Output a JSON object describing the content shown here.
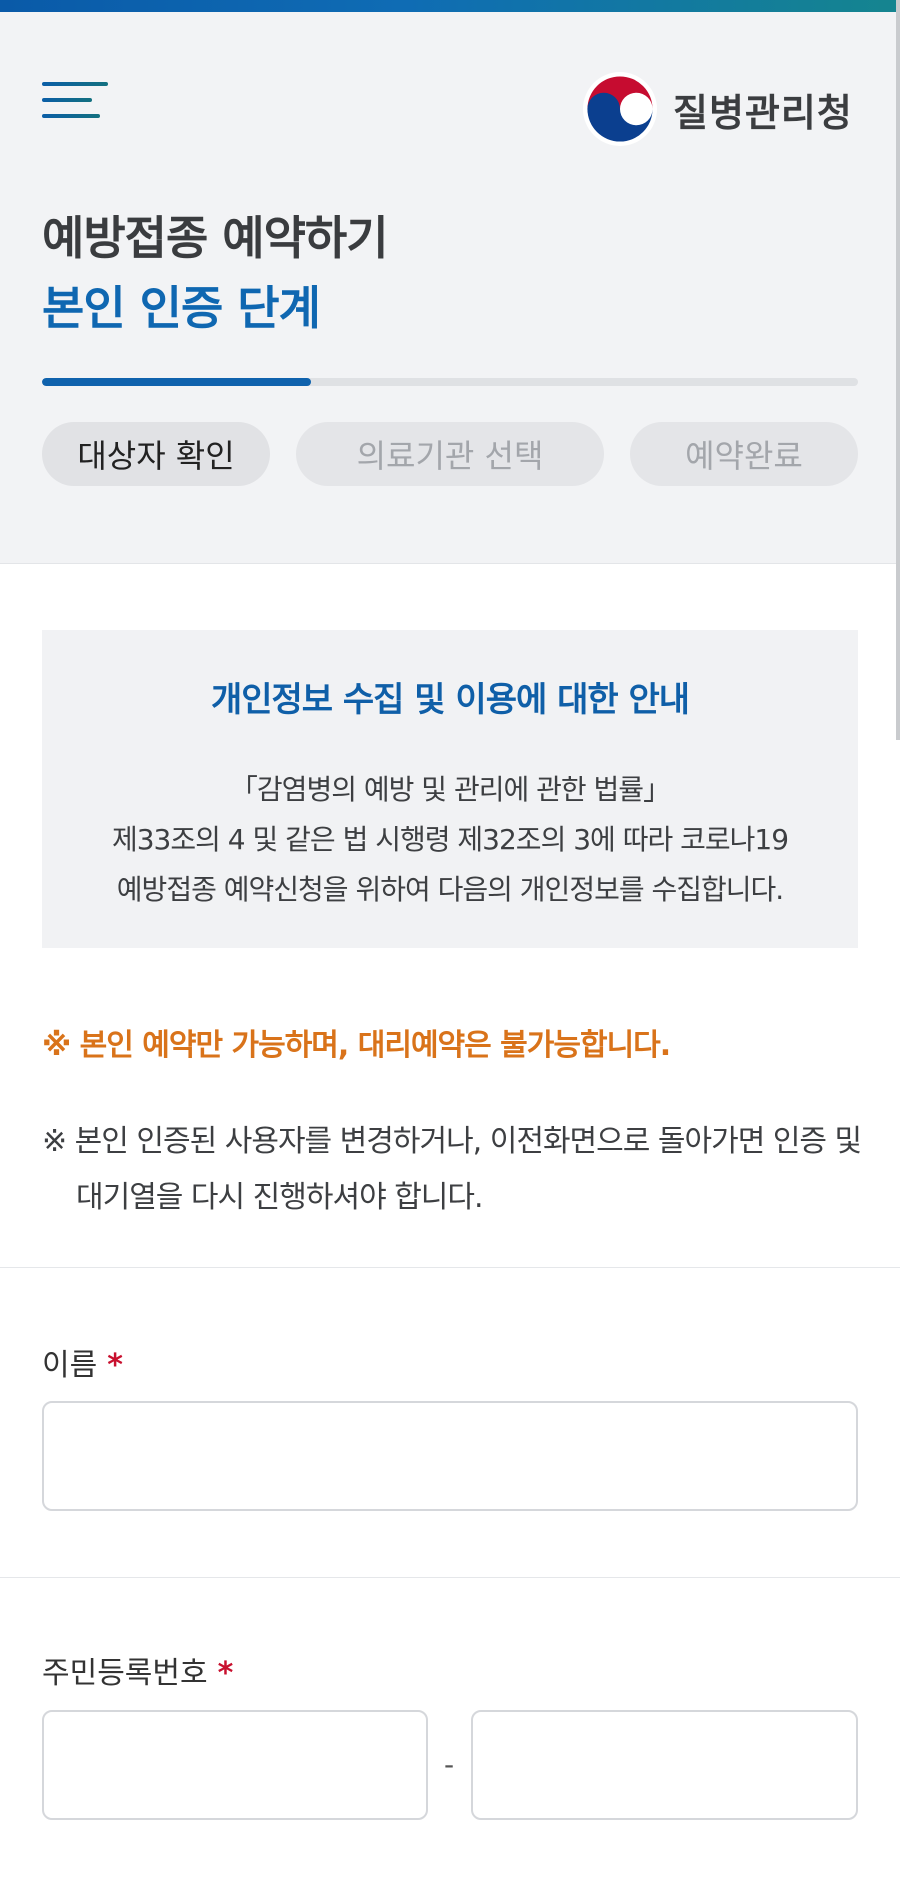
{
  "header": {
    "menu_icon": "hamburger-menu-icon",
    "logo_icon": "taegeuk-emblem-icon",
    "logo_text": "질병관리청",
    "title": "예방접종 예약하기",
    "subtitle": "본인 인증 단계",
    "progress_fraction": 0.33,
    "steps": [
      {
        "label": "대상자 확인",
        "active": true
      },
      {
        "label": "의료기관 선택",
        "active": false
      },
      {
        "label": "예약완료",
        "active": false
      }
    ]
  },
  "notice": {
    "title": "개인정보 수집 및 이용에 대한 안내",
    "lines": [
      "「감염병의 예방 및 관리에 관한 법률」",
      "제33조의 4 및 같은 법 시행령 제32조의 3에 따라 코로나19",
      "예방접종 예약신청을 위하여 다음의 개인정보를 수집합니다."
    ]
  },
  "warnings": {
    "orange": "※ 본인 예약만 가능하며, 대리예약은 불가능합니다.",
    "gray_line1": "※ 본인 인증된 사용자를 변경하거나, 이전화면으로 돌아가면 인증 및",
    "gray_line2": "대기열을 다시 진행하셔야 합니다."
  },
  "form": {
    "name_label": "이름",
    "required_mark": "*",
    "name_value": "",
    "rrn_label": "주민등록번호",
    "rrn_front_value": "",
    "rrn_back_value": "",
    "rrn_separator": "-"
  },
  "colors": {
    "brand_blue": "#0f67b1",
    "warning_orange": "#d9731a",
    "required_red": "#c8102e"
  }
}
